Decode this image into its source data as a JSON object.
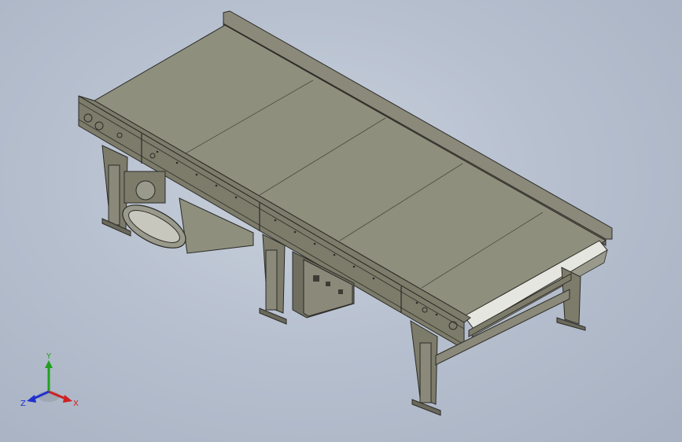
{
  "viewport": {
    "model": "belt-conveyor-assembly",
    "colors": {
      "background": "#b7c0cf",
      "belt_top": "#8f8f7e",
      "frame": "#7d7c6b",
      "frame_dark": "#5e5e50",
      "edge": "#2b2b26",
      "roller": "#e6e6e0"
    }
  },
  "triad": {
    "x_label": "X",
    "y_label": "Y",
    "z_label": "Z",
    "x_color": "#d02020",
    "y_color": "#20a020",
    "z_color": "#2030d0"
  }
}
